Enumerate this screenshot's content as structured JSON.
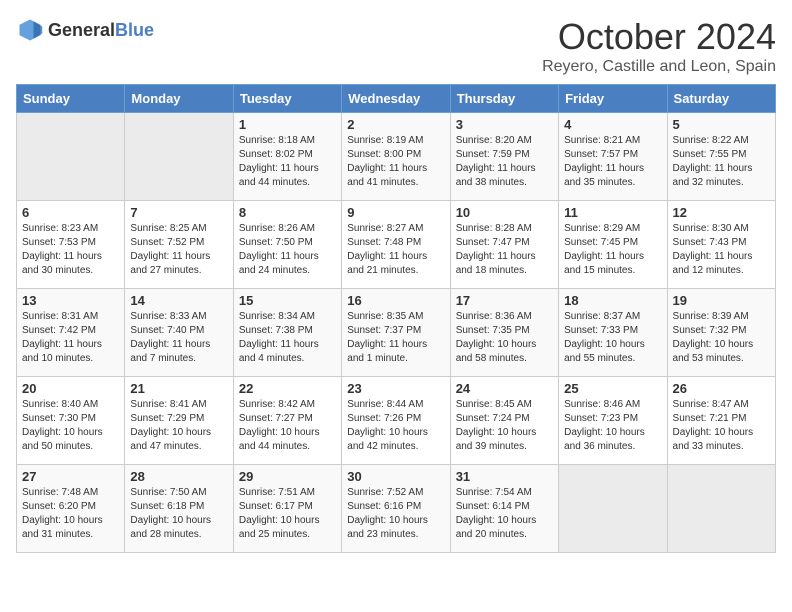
{
  "header": {
    "logo_general": "General",
    "logo_blue": "Blue",
    "month": "October 2024",
    "location": "Reyero, Castille and Leon, Spain"
  },
  "weekdays": [
    "Sunday",
    "Monday",
    "Tuesday",
    "Wednesday",
    "Thursday",
    "Friday",
    "Saturday"
  ],
  "weeks": [
    [
      {
        "day": "",
        "info": ""
      },
      {
        "day": "",
        "info": ""
      },
      {
        "day": "1",
        "info": "Sunrise: 8:18 AM\nSunset: 8:02 PM\nDaylight: 11 hours and 44 minutes."
      },
      {
        "day": "2",
        "info": "Sunrise: 8:19 AM\nSunset: 8:00 PM\nDaylight: 11 hours and 41 minutes."
      },
      {
        "day": "3",
        "info": "Sunrise: 8:20 AM\nSunset: 7:59 PM\nDaylight: 11 hours and 38 minutes."
      },
      {
        "day": "4",
        "info": "Sunrise: 8:21 AM\nSunset: 7:57 PM\nDaylight: 11 hours and 35 minutes."
      },
      {
        "day": "5",
        "info": "Sunrise: 8:22 AM\nSunset: 7:55 PM\nDaylight: 11 hours and 32 minutes."
      }
    ],
    [
      {
        "day": "6",
        "info": "Sunrise: 8:23 AM\nSunset: 7:53 PM\nDaylight: 11 hours and 30 minutes."
      },
      {
        "day": "7",
        "info": "Sunrise: 8:25 AM\nSunset: 7:52 PM\nDaylight: 11 hours and 27 minutes."
      },
      {
        "day": "8",
        "info": "Sunrise: 8:26 AM\nSunset: 7:50 PM\nDaylight: 11 hours and 24 minutes."
      },
      {
        "day": "9",
        "info": "Sunrise: 8:27 AM\nSunset: 7:48 PM\nDaylight: 11 hours and 21 minutes."
      },
      {
        "day": "10",
        "info": "Sunrise: 8:28 AM\nSunset: 7:47 PM\nDaylight: 11 hours and 18 minutes."
      },
      {
        "day": "11",
        "info": "Sunrise: 8:29 AM\nSunset: 7:45 PM\nDaylight: 11 hours and 15 minutes."
      },
      {
        "day": "12",
        "info": "Sunrise: 8:30 AM\nSunset: 7:43 PM\nDaylight: 11 hours and 12 minutes."
      }
    ],
    [
      {
        "day": "13",
        "info": "Sunrise: 8:31 AM\nSunset: 7:42 PM\nDaylight: 11 hours and 10 minutes."
      },
      {
        "day": "14",
        "info": "Sunrise: 8:33 AM\nSunset: 7:40 PM\nDaylight: 11 hours and 7 minutes."
      },
      {
        "day": "15",
        "info": "Sunrise: 8:34 AM\nSunset: 7:38 PM\nDaylight: 11 hours and 4 minutes."
      },
      {
        "day": "16",
        "info": "Sunrise: 8:35 AM\nSunset: 7:37 PM\nDaylight: 11 hours and 1 minute."
      },
      {
        "day": "17",
        "info": "Sunrise: 8:36 AM\nSunset: 7:35 PM\nDaylight: 10 hours and 58 minutes."
      },
      {
        "day": "18",
        "info": "Sunrise: 8:37 AM\nSunset: 7:33 PM\nDaylight: 10 hours and 55 minutes."
      },
      {
        "day": "19",
        "info": "Sunrise: 8:39 AM\nSunset: 7:32 PM\nDaylight: 10 hours and 53 minutes."
      }
    ],
    [
      {
        "day": "20",
        "info": "Sunrise: 8:40 AM\nSunset: 7:30 PM\nDaylight: 10 hours and 50 minutes."
      },
      {
        "day": "21",
        "info": "Sunrise: 8:41 AM\nSunset: 7:29 PM\nDaylight: 10 hours and 47 minutes."
      },
      {
        "day": "22",
        "info": "Sunrise: 8:42 AM\nSunset: 7:27 PM\nDaylight: 10 hours and 44 minutes."
      },
      {
        "day": "23",
        "info": "Sunrise: 8:44 AM\nSunset: 7:26 PM\nDaylight: 10 hours and 42 minutes."
      },
      {
        "day": "24",
        "info": "Sunrise: 8:45 AM\nSunset: 7:24 PM\nDaylight: 10 hours and 39 minutes."
      },
      {
        "day": "25",
        "info": "Sunrise: 8:46 AM\nSunset: 7:23 PM\nDaylight: 10 hours and 36 minutes."
      },
      {
        "day": "26",
        "info": "Sunrise: 8:47 AM\nSunset: 7:21 PM\nDaylight: 10 hours and 33 minutes."
      }
    ],
    [
      {
        "day": "27",
        "info": "Sunrise: 7:48 AM\nSunset: 6:20 PM\nDaylight: 10 hours and 31 minutes."
      },
      {
        "day": "28",
        "info": "Sunrise: 7:50 AM\nSunset: 6:18 PM\nDaylight: 10 hours and 28 minutes."
      },
      {
        "day": "29",
        "info": "Sunrise: 7:51 AM\nSunset: 6:17 PM\nDaylight: 10 hours and 25 minutes."
      },
      {
        "day": "30",
        "info": "Sunrise: 7:52 AM\nSunset: 6:16 PM\nDaylight: 10 hours and 23 minutes."
      },
      {
        "day": "31",
        "info": "Sunrise: 7:54 AM\nSunset: 6:14 PM\nDaylight: 10 hours and 20 minutes."
      },
      {
        "day": "",
        "info": ""
      },
      {
        "day": "",
        "info": ""
      }
    ]
  ]
}
